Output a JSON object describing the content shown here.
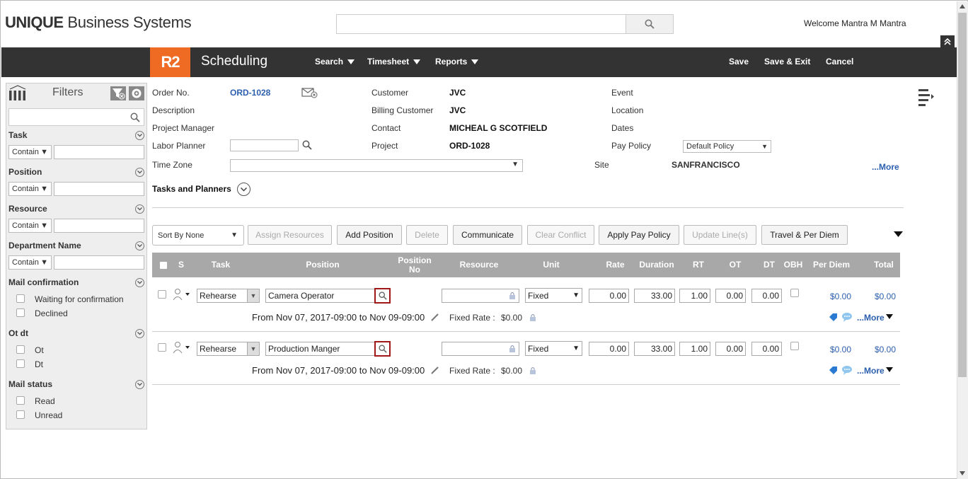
{
  "header": {
    "logo_bold": "UNIQUE",
    "logo_rest": "Business Systems",
    "welcome": "Welcome Mantra M Mantra"
  },
  "nav": {
    "badge": "R2",
    "title": "Scheduling",
    "menus": [
      "Search",
      "Timesheet",
      "Reports"
    ],
    "actions": [
      "Save",
      "Save & Exit",
      "Cancel"
    ]
  },
  "sidebar": {
    "title": "Filters",
    "sections": [
      {
        "label": "Task",
        "op": "Contain"
      },
      {
        "label": "Position",
        "op": "Contain"
      },
      {
        "label": "Resource",
        "op": "Contain"
      },
      {
        "label": "Department Name",
        "op": "Contain"
      }
    ],
    "checkgroups": [
      {
        "label": "Mail confirmation",
        "items": [
          "Waiting for confirmation",
          "Declined"
        ]
      },
      {
        "label": "Ot dt",
        "items": [
          "Ot",
          "Dt"
        ]
      },
      {
        "label": "Mail status",
        "items": [
          "Read",
          "Unread"
        ]
      }
    ]
  },
  "order": {
    "order_no_label": "Order No.",
    "order_no": "ORD-1028",
    "description_label": "Description",
    "pm_label": "Project Manager",
    "labor_planner_label": "Labor Planner",
    "timezone_label": "Time Zone",
    "customer_label": "Customer",
    "customer": "JVC",
    "billing_label": "Billing Customer",
    "billing": "JVC",
    "contact_label": "Contact",
    "contact": "MICHEAL G SCOTFIELD",
    "project_label": "Project",
    "project": "ORD-1028",
    "event_label": "Event",
    "location_label": "Location",
    "dates_label": "Dates",
    "pay_policy_label": "Pay Policy",
    "pay_policy": "Default Policy",
    "site_label": "Site",
    "site": "SANFRANCISCO",
    "more": "...More",
    "tasks_planners": "Tasks and Planners"
  },
  "toolbar": {
    "sort": "Sort By None",
    "buttons": [
      "Assign Resources",
      "Add Position",
      "Delete",
      "Communicate",
      "Clear Conflict",
      "Apply Pay Policy",
      "Update Line(s)",
      "Travel & Per Diem"
    ]
  },
  "table": {
    "headers": [
      "S",
      "Task",
      "Position",
      "Position No",
      "Resource",
      "Unit",
      "Rate",
      "Duration",
      "RT",
      "OT",
      "DT",
      "OBH",
      "Per Diem",
      "Total"
    ],
    "rows": [
      {
        "task": "Rehearse",
        "position": "Camera Operator",
        "unit": "Fixed",
        "rate": "0.00",
        "duration": "33.00",
        "rt": "1.00",
        "ot": "0.00",
        "dt": "0.00",
        "per_diem": "$0.00",
        "total": "$0.00",
        "dates": "From Nov 07, 2017-09:00 to Nov 09-09:00",
        "fixed_rate_label": "Fixed Rate :",
        "fixed_rate": "$0.00",
        "more": "...More"
      },
      {
        "task": "Rehearse",
        "position": "Production Manger",
        "unit": "Fixed",
        "rate": "0.00",
        "duration": "33.00",
        "rt": "1.00",
        "ot": "0.00",
        "dt": "0.00",
        "per_diem": "$0.00",
        "total": "$0.00",
        "dates": "From Nov 07, 2017-09:00 to Nov 09-09:00",
        "fixed_rate_label": "Fixed Rate :",
        "fixed_rate": "$0.00",
        "more": "...More"
      }
    ]
  },
  "colors": {
    "brand": "#ef6b23",
    "navbar": "#333333",
    "link": "#2c5fad",
    "highlight": "#a01818"
  }
}
